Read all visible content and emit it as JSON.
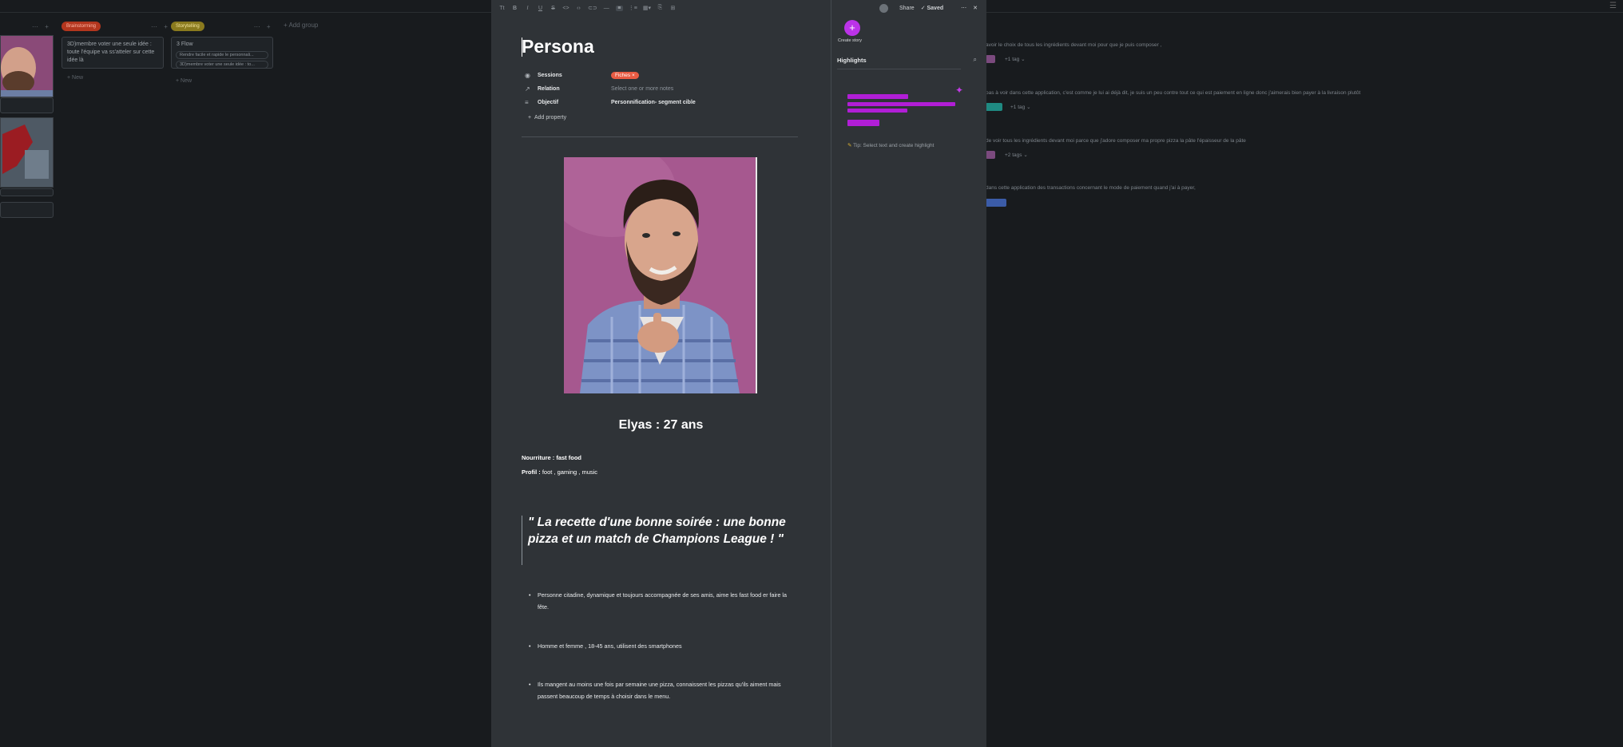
{
  "background": {
    "groups": [
      {
        "label": "Brainstorming",
        "color": "#b3361e"
      },
      {
        "label": "Storytelling",
        "color": "#8a7a1e"
      }
    ],
    "add_group_label": "Add group",
    "cards": [
      {
        "text": "3D)membre voter une seule idée : toute l'équipe va ss'atteler sur cette idée là"
      },
      {
        "title": "3 Flow",
        "chips": [
          "Rendre facile et rapide le personnali...",
          "3D)membre voter une seule idée : to..."
        ]
      }
    ],
    "new_label": "New",
    "right_lines": [
      {
        "text": "avoir le choix de tous les ingrédients devant moi pour que je puis composer ,"
      },
      {
        "text": "pas à voir dans cette application, c'est comme je lui ai déjà dit, je suis un peu contre tout ce qui est paiement en ligne donc j'aimerais bien payer à la livraison plutôt"
      },
      {
        "text": "de voir tous les ingrédients devant moi parce que j'adore composer ma propre pizza la pâte l'épaisseur de la pâte"
      },
      {
        "text": "dans cette application des transactions concernant le mode de paiement quand j'ai à payer,"
      }
    ],
    "right_tags": [
      "+1 tag",
      "+1 tag",
      "+2 tags"
    ]
  },
  "doc": {
    "toolbar": [
      "Tt",
      "B",
      "I",
      "U",
      "S",
      "<>",
      "‹›",
      "⊂⊃",
      "—",
      "≡",
      "⋮≡",
      "▦▾",
      "⎘",
      "⊞"
    ],
    "title": "Persona",
    "properties": [
      {
        "label": "Sessions",
        "value": "Fiches",
        "icon": "target-icon"
      },
      {
        "label": "Relation",
        "value": "Select one or more notes",
        "icon": "arrow-icon"
      },
      {
        "label": "Objectif",
        "value": "Personnification- segment cible",
        "icon": "text-icon"
      }
    ],
    "add_property": "Add property",
    "heading": "Elyas : 27 ans",
    "lines": [
      {
        "label": "Nourriture : fast food",
        "rest": ""
      },
      {
        "label": "Profil :",
        "rest": " foot , gaming , music"
      }
    ],
    "quote": "\" La recette d'une bonne soirée : une bonne pizza et un match de Champions League ! \"",
    "bullets": [
      "Personne citadine, dynamique et toujours accompagnée de ses amis, aime les fast food er faire la fête.",
      "Homme et femme , 18-45 ans, utilisent des smartphones",
      "Ils mangent au moins une fois par semaine une pizza, connaissent les pizzas qu'ils aiment mais passent beaucoup de temps à choisir dans le menu."
    ]
  },
  "header": {
    "share_label": "Share",
    "saved_label": "Saved"
  },
  "highlights": {
    "create_label": "Create story",
    "title": "Highlights",
    "tip": "Tip: Select text and create highlight",
    "accent": "#b11ed6"
  }
}
